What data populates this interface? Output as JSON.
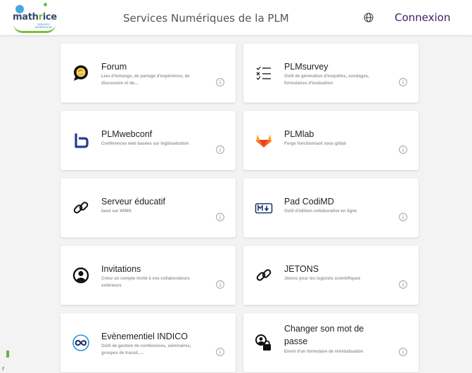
{
  "header": {
    "logo_text": "mathrice",
    "logo_tagline": "SERVICES NUMÉRIQUES",
    "title": "Services Numériques de la PLM",
    "login_label": "Connexion"
  },
  "services": [
    {
      "title": "Forum",
      "description": "Lieu d'échange, de partage d'expérience, de discussion et de..."
    },
    {
      "title": "PLMsurvey",
      "description": "Outil de génération d'enquêtes, sondages, formulaires d'évaluation"
    },
    {
      "title": "PLMwebconf",
      "description": "Conférences web basées sur bigbluebutton"
    },
    {
      "title": "PLMlab",
      "description": "Forge fonctionnant sous gitlab"
    },
    {
      "title": "Serveur éducatif",
      "description": "basé sur WIMS"
    },
    {
      "title": "Pad CodiMD",
      "description": "Outil d'édition collaborative en ligne"
    },
    {
      "title": "Invitations",
      "description": "Créez un compte invité à vos collaborateurs extérieurs"
    },
    {
      "title": "JETONS",
      "description": "Jetons pour les logiciels scientifiques"
    },
    {
      "title": "Evènementiel INDICO",
      "description": "Outil de gestion de conférences, séminaires, groupes de travail, ..."
    },
    {
      "title": "Changer son mot de passe",
      "description": "Envoi d'un formulaire de réinitialisation"
    }
  ],
  "side_text": "r",
  "colors": {
    "accent": "#3c1f62",
    "card_bg": "#ffffff",
    "page_bg": "#f3f3f3"
  }
}
